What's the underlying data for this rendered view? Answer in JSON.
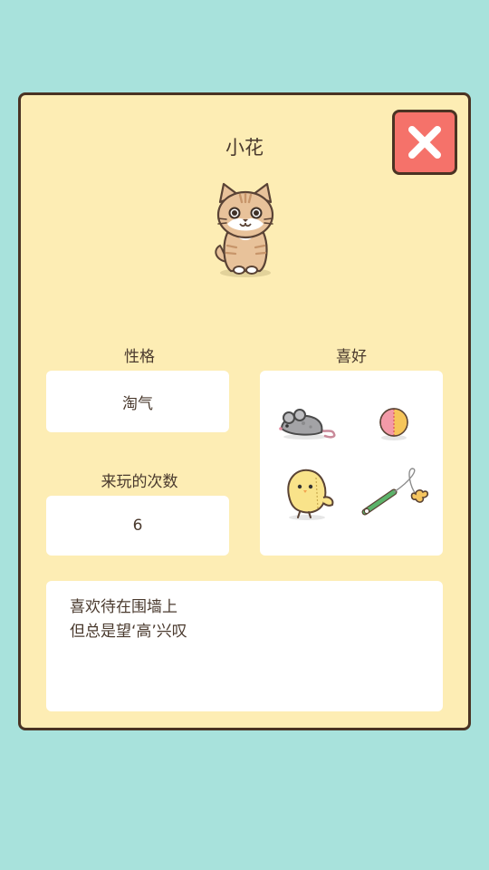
{
  "profile": {
    "name": "小花",
    "personality_label": "性格",
    "personality_value": "淘气",
    "favorites_label": "喜好",
    "visits_label": "来玩的次数",
    "visits_value": "6",
    "description_lines": [
      "喜欢待在围墙上",
      "但总是望‘高’兴叹"
    ]
  },
  "favorites": [
    {
      "icon": "toy-mouse-icon"
    },
    {
      "icon": "ball-icon"
    },
    {
      "icon": "chick-toy-icon"
    },
    {
      "icon": "cat-teaser-wand-icon"
    }
  ],
  "colors": {
    "background": "#a8e2dc",
    "card": "#fdedb4",
    "border": "#4a3323",
    "close_button": "#f5726a",
    "panel": "#ffffff"
  }
}
